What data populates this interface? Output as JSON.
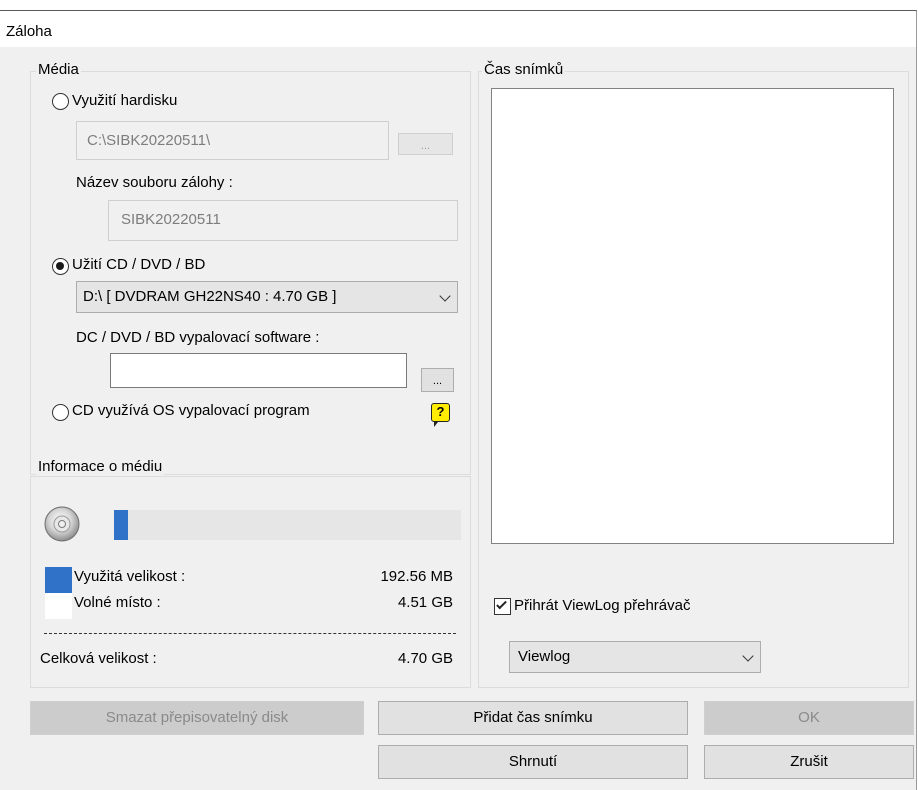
{
  "window": {
    "title": "Záloha"
  },
  "media": {
    "legend": "Média",
    "hdd_option": {
      "label": "Využití hardisku",
      "selected": false
    },
    "hdd_path": "C:\\SIBK20220511\\",
    "browse_label": "...",
    "filename_label": "Název souboru zálohy :",
    "filename_value": "SIBK20220511",
    "cd_option": {
      "label": "Užití CD / DVD / BD",
      "selected": true
    },
    "drive_select": "D:\\ [ DVDRAM GH22NS40  : 4.70 GB ]",
    "burn_software_label": "DC / DVD / BD vypalovací software :",
    "burn_software_value": "",
    "os_burn_option": {
      "label": "CD využívá OS vypalovací program",
      "selected": false
    },
    "help_icon": "?"
  },
  "media_info": {
    "legend": "Informace o médiu",
    "disc_icon": "cd-disc-icon",
    "used_fraction": 0.04,
    "used_label": "Využitá velikost :",
    "used_value": "192.56 MB",
    "free_label": "Volné místo :",
    "free_value": "4.51 GB",
    "total_label": "Celková velikost :",
    "total_value": "4.70 GB",
    "used_color": "#2f72c8",
    "free_color": "#ffffff"
  },
  "snapshots": {
    "legend": "Čas snímků",
    "items": []
  },
  "viewlog": {
    "checkbox_label": "Přihrát ViewLog přehrávač",
    "checked": true,
    "select_value": "Viewlog"
  },
  "buttons": {
    "erase_disc": "Smazat přepisovatelný disk",
    "add_snapshot": "Přidat čas snímku",
    "ok": "OK",
    "summary": "Shrnutí",
    "cancel": "Zrušit"
  }
}
